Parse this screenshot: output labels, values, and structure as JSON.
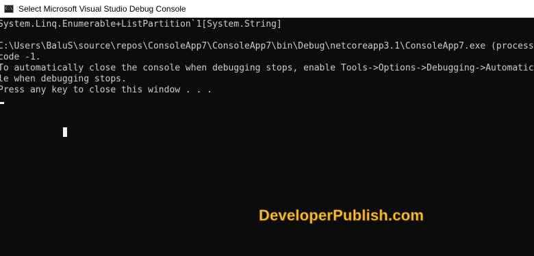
{
  "window": {
    "title": "Select Microsoft Visual Studio Debug Console",
    "icon": "console-app-icon",
    "icon_text": "C:\\"
  },
  "console": {
    "lines": [
      "System.Linq.Enumerable+ListPartition`1[System.String]",
      "",
      "C:\\Users\\BaluS\\source\\repos\\ConsoleApp7\\ConsoleApp7\\bin\\Debug\\netcoreapp3.1\\ConsoleApp7.exe (process",
      "code -1.",
      "To automatically close the console when debugging stops, enable Tools->Options->Debugging->Automatic",
      "le when debugging stops.",
      "Press any key to close this window . . ."
    ],
    "background_color": "#0c0c0c",
    "text_color": "#cccccc"
  },
  "watermark": {
    "text": "DeveloperPublish.com",
    "color": "#f5c542"
  }
}
